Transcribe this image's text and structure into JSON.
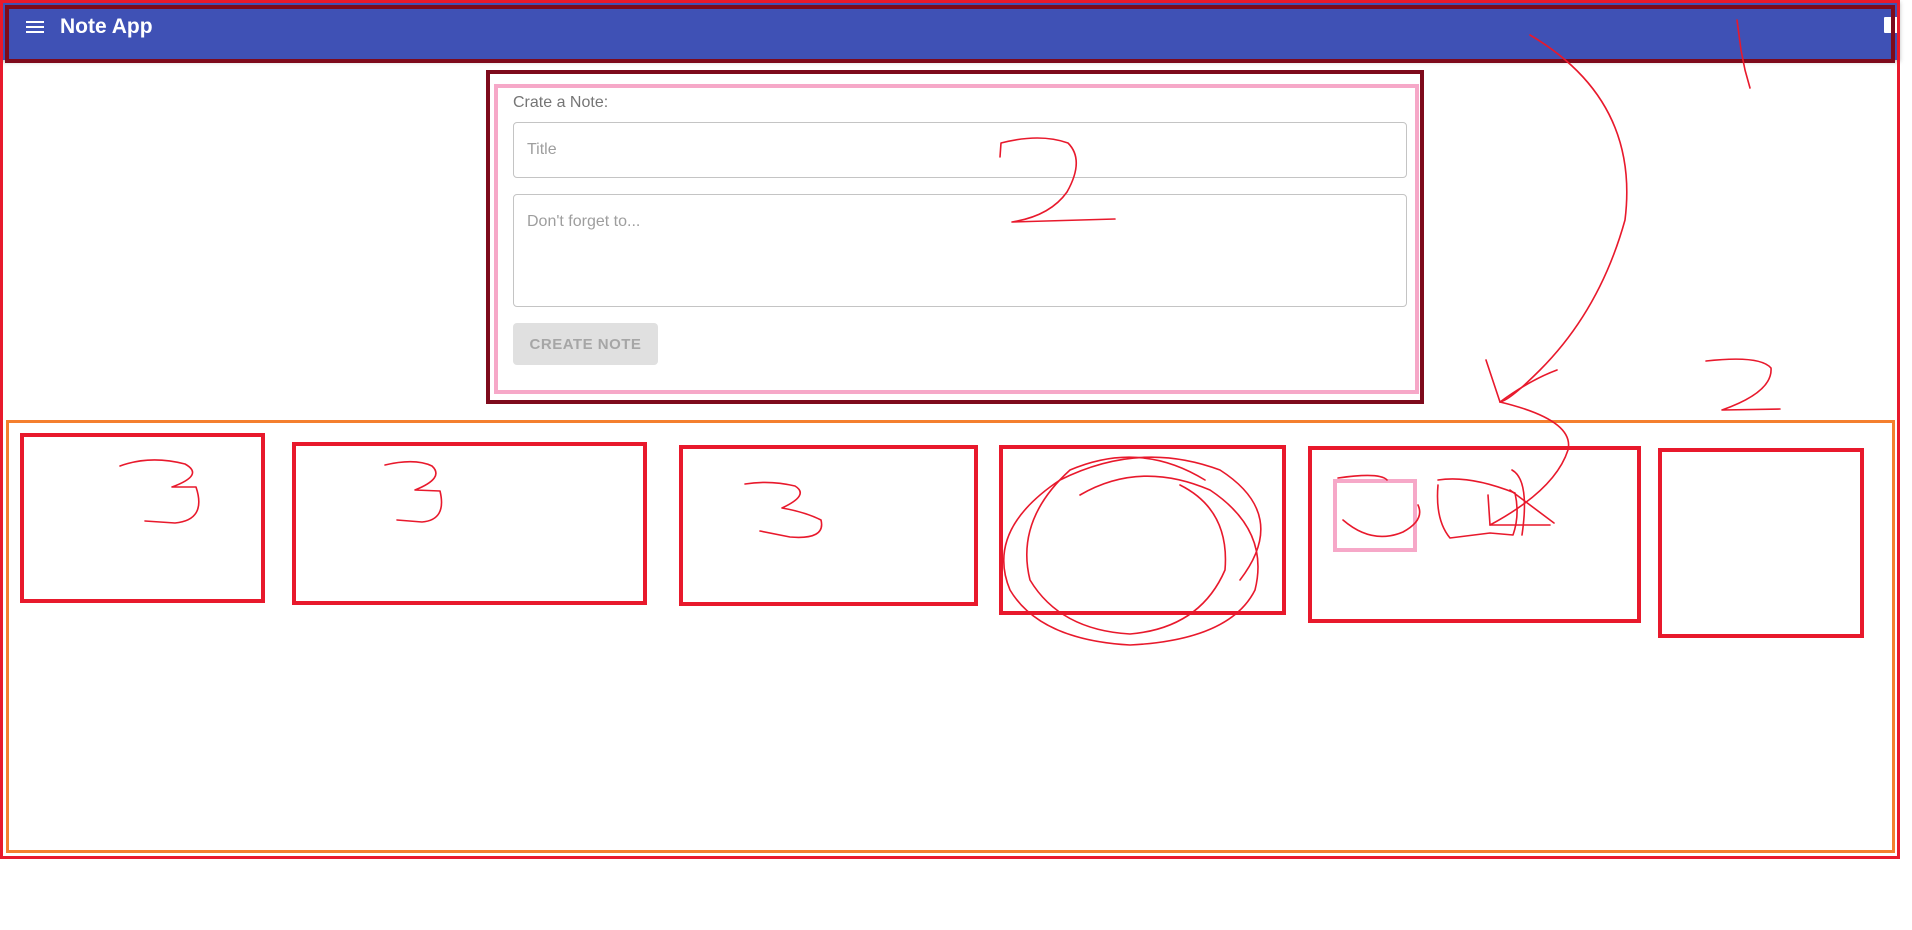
{
  "appbar": {
    "title": "Note App",
    "menu_icon": "hamburger-menu-icon",
    "corner_icon": "square-icon",
    "background": "#3f51b5"
  },
  "create_note": {
    "label": "Crate a Note:",
    "title_placeholder": "Title",
    "body_placeholder": "Don't forget to...",
    "button_label": "CREATE NOTE"
  },
  "annotations": {
    "labels": [
      "1",
      "2",
      "3",
      "3",
      "3",
      "2"
    ]
  },
  "notes_count": 6,
  "colors": {
    "annotation_red": "#e8192c",
    "annotation_dark_red": "#7e0a1c",
    "annotation_pink": "#f6a8c8",
    "annotation_orange": "#f47f2e",
    "button_bg": "#e0e0e0"
  }
}
